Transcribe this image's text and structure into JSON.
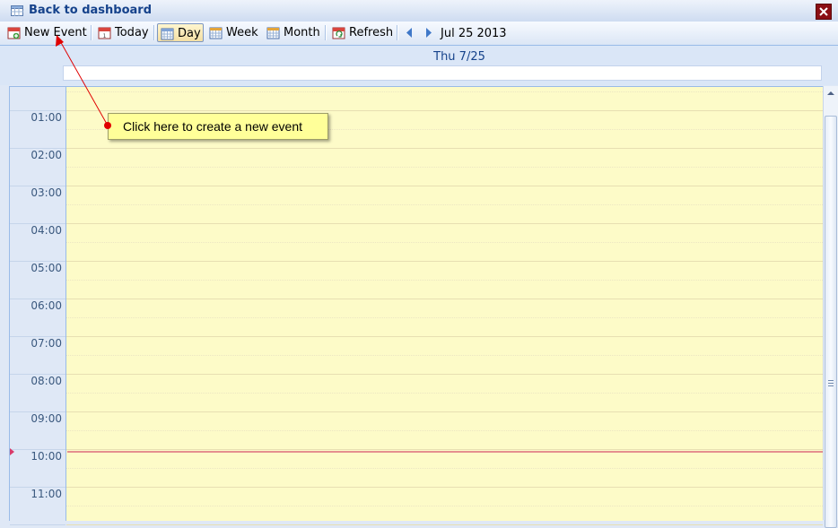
{
  "window": {
    "title": "Back to dashboard"
  },
  "toolbar": {
    "new_event": "New Event",
    "today": "Today",
    "day": "Day",
    "week": "Week",
    "month": "Month",
    "refresh": "Refresh",
    "current_date": "Jul 25 2013",
    "active_view": "Day"
  },
  "day_header": {
    "label": "Thu 7/25"
  },
  "hours": [
    "01:00",
    "02:00",
    "03:00",
    "04:00",
    "05:00",
    "06:00",
    "07:00",
    "08:00",
    "09:00",
    "10:00",
    "11:00"
  ],
  "tooltip": {
    "text": "Click here to create a new event"
  },
  "colors": {
    "accent": "#15428b",
    "grid_bg": "#fdfbc8",
    "now_line": "#e58f8f",
    "tooltip_bg": "#ffff99",
    "close_bg": "#8b0f14"
  }
}
